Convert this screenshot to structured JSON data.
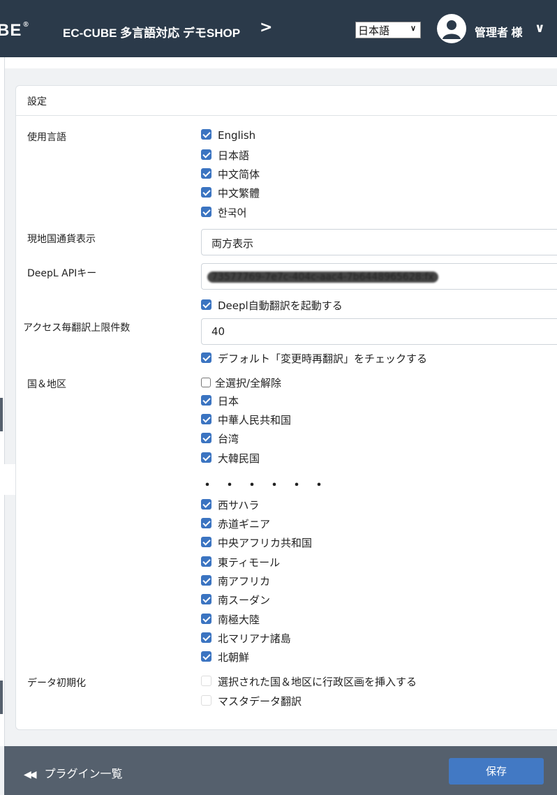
{
  "header": {
    "logo_text": "BE",
    "shop_title": "EC-CUBE 多言語対応 デモSHOP",
    "language_selected": "日本語",
    "user_name": "管理者 様"
  },
  "card": {
    "title": "設定",
    "languages": {
      "label": "使用言語",
      "options": [
        "English",
        "日本語",
        "中文简体",
        "中文繁體",
        "한국어"
      ]
    },
    "currency": {
      "label": "現地国通貨表示",
      "value": "両方表示"
    },
    "deepl": {
      "label": "DeepL APIキー",
      "value": "73577769-7e7c-404c-aac4-7b6448965628:fx",
      "auto_translate": "Deepl自動翻訳を起動する"
    },
    "limit": {
      "label": "アクセス毎翻訳上限件数",
      "value": "40",
      "default_check": "デフォルト「変更時再翻訳」をチェックする"
    },
    "countries": {
      "label": "国＆地区",
      "select_all": "全選択/全解除",
      "first": [
        "日本",
        "中華人民共和国",
        "台湾",
        "大韓民国"
      ],
      "ellipsis": "・・・・・・",
      "rest": [
        "西サハラ",
        "赤道ギニア",
        "中央アフリカ共和国",
        "東ティモール",
        "南アフリカ",
        "南スーダン",
        "南極大陸",
        "北マリアナ諸島",
        "北朝鮮"
      ]
    },
    "init": {
      "label": "データ初期化",
      "options": [
        "選択された国＆地区に行政区画を挿入する",
        "マスタデータ翻訳"
      ]
    }
  },
  "footer": {
    "back_label": "プラグイン一覧",
    "save_label": "保存"
  },
  "colors": {
    "header_bg": "#2b3a4a",
    "checkbox": "#3b74c1",
    "save_button": "#4279c4",
    "footer_bg": "#55606d"
  }
}
